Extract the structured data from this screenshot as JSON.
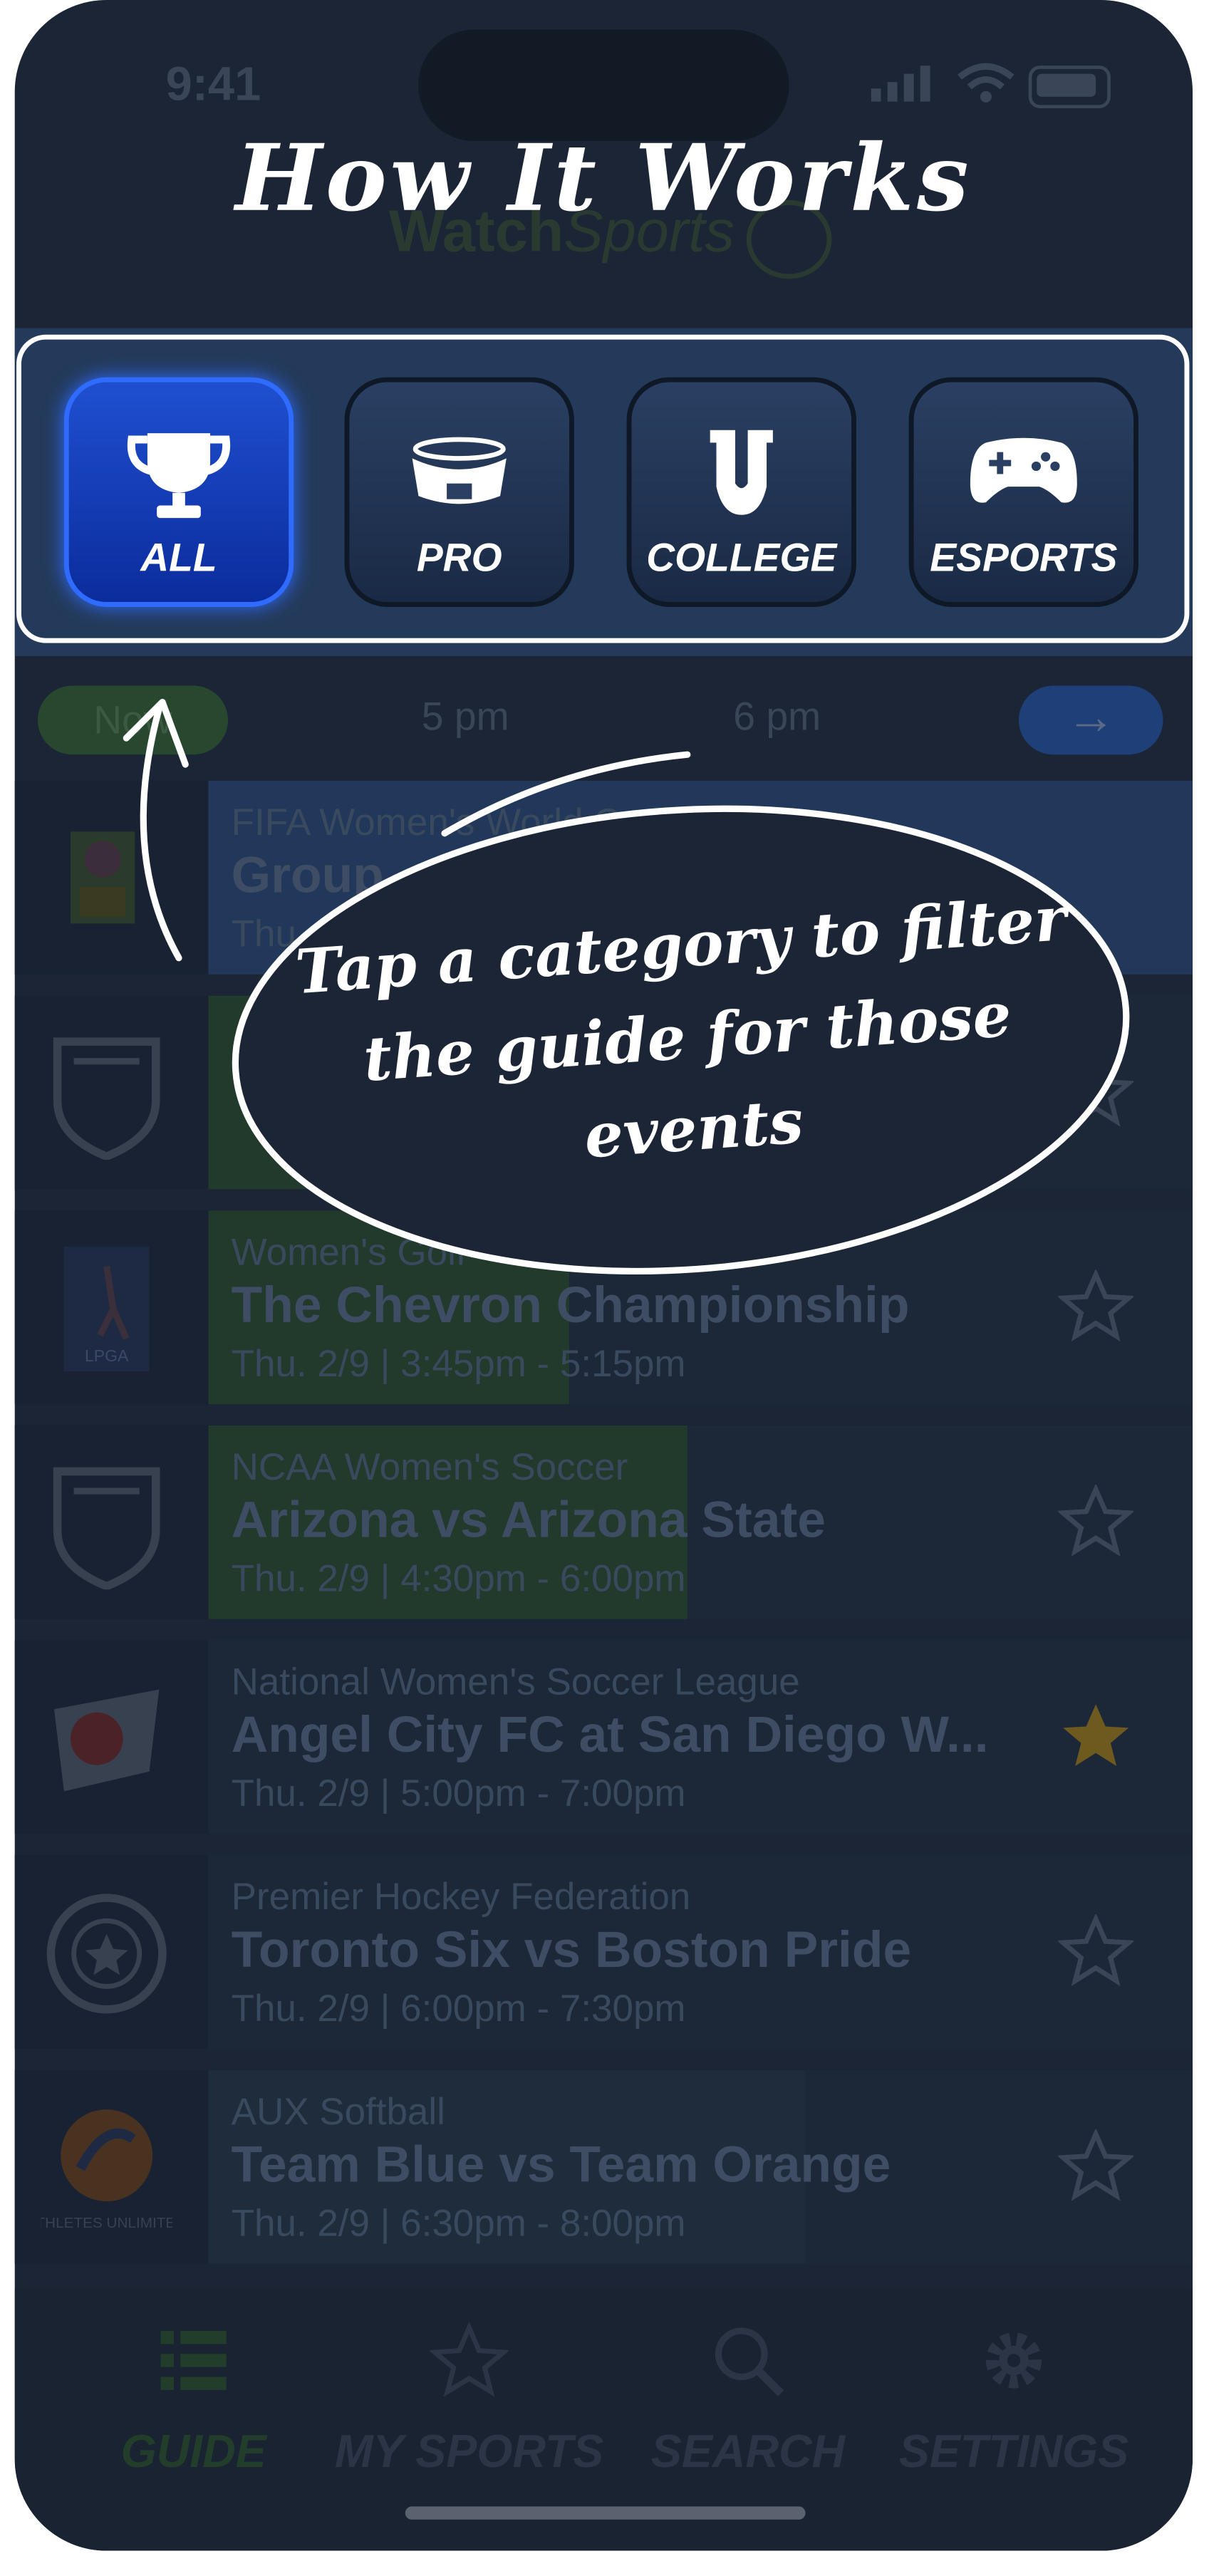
{
  "status_bar": {
    "time": "9:41"
  },
  "header": {
    "overlay_title": "How It Works",
    "logo_main": "Watch",
    "logo_italic": "Sports"
  },
  "categories": [
    {
      "label": "ALL",
      "icon": "trophy-icon",
      "active": true
    },
    {
      "label": "PRO",
      "icon": "stadium-icon",
      "active": false
    },
    {
      "label": "COLLEGE",
      "icon": "college-u-icon",
      "active": false
    },
    {
      "label": "ESPORTS",
      "icon": "gamepad-icon",
      "active": false
    }
  ],
  "timeline": {
    "now_label": "Now",
    "slots": [
      "5 pm",
      "6 pm"
    ],
    "next_icon": "arrow-right-icon",
    "next_symbol": "→"
  },
  "tooltip": {
    "text": "Tap a category to filter the guide for those events"
  },
  "events": [
    {
      "category": "FIFA Women's World Cup",
      "title": "Group",
      "time": "Thu.",
      "starred": false,
      "highlighted": true,
      "logo": "fifa-womens-world-cup-logo",
      "progress": 0
    },
    {
      "category": "",
      "title": "",
      "time": "",
      "starred": false,
      "highlighted": false,
      "logo": "pac12-logo",
      "progress": 0.25
    },
    {
      "category": "Women's Golf",
      "title": "The Chevron Championship",
      "time": "Thu. 2/9  |  3:45pm - 5:15pm",
      "starred": false,
      "highlighted": false,
      "logo": "lpga-logo",
      "progress": 0.37
    },
    {
      "category": "NCAA Women's Soccer",
      "title": "Arizona vs Arizona State",
      "time": "Thu. 2/9  |  4:30pm - 6:00pm",
      "starred": false,
      "highlighted": false,
      "logo": "pac12-logo",
      "progress": 0.49
    },
    {
      "category": "National Women's Soccer League",
      "title": "Angel City FC at San Diego W...",
      "time": "Thu. 2/9  |  5:00pm - 7:00pm",
      "starred": true,
      "highlighted": false,
      "logo": "nwsl-logo",
      "progress": 0
    },
    {
      "category": "Premier Hockey Federation",
      "title": "Toronto Six vs Boston Pride",
      "time": "Thu. 2/9  |  6:00pm - 7:30pm",
      "starred": false,
      "highlighted": false,
      "logo": "phf-logo",
      "progress": 0
    },
    {
      "category": "AUX Softball",
      "title": "Team Blue vs Team Orange",
      "time": "Thu. 2/9  |  6:30pm - 8:00pm",
      "starred": false,
      "highlighted": false,
      "logo": "athletes-unlimited-logo",
      "logo_text": "ATHLETES UNLIMITED",
      "progress": 0
    }
  ],
  "tabs": [
    {
      "label": "GUIDE",
      "icon": "list-icon",
      "active": true
    },
    {
      "label": "MY SPORTS",
      "icon": "star-icon",
      "active": false
    },
    {
      "label": "SEARCH",
      "icon": "search-icon",
      "active": false
    },
    {
      "label": "SETTINGS",
      "icon": "gear-icon",
      "active": false
    }
  ],
  "colors": {
    "accent_blue": "#1f4fd0",
    "background": "#1b2535",
    "star_gold": "#6e5a1e",
    "guide_green": "#233d2b"
  }
}
